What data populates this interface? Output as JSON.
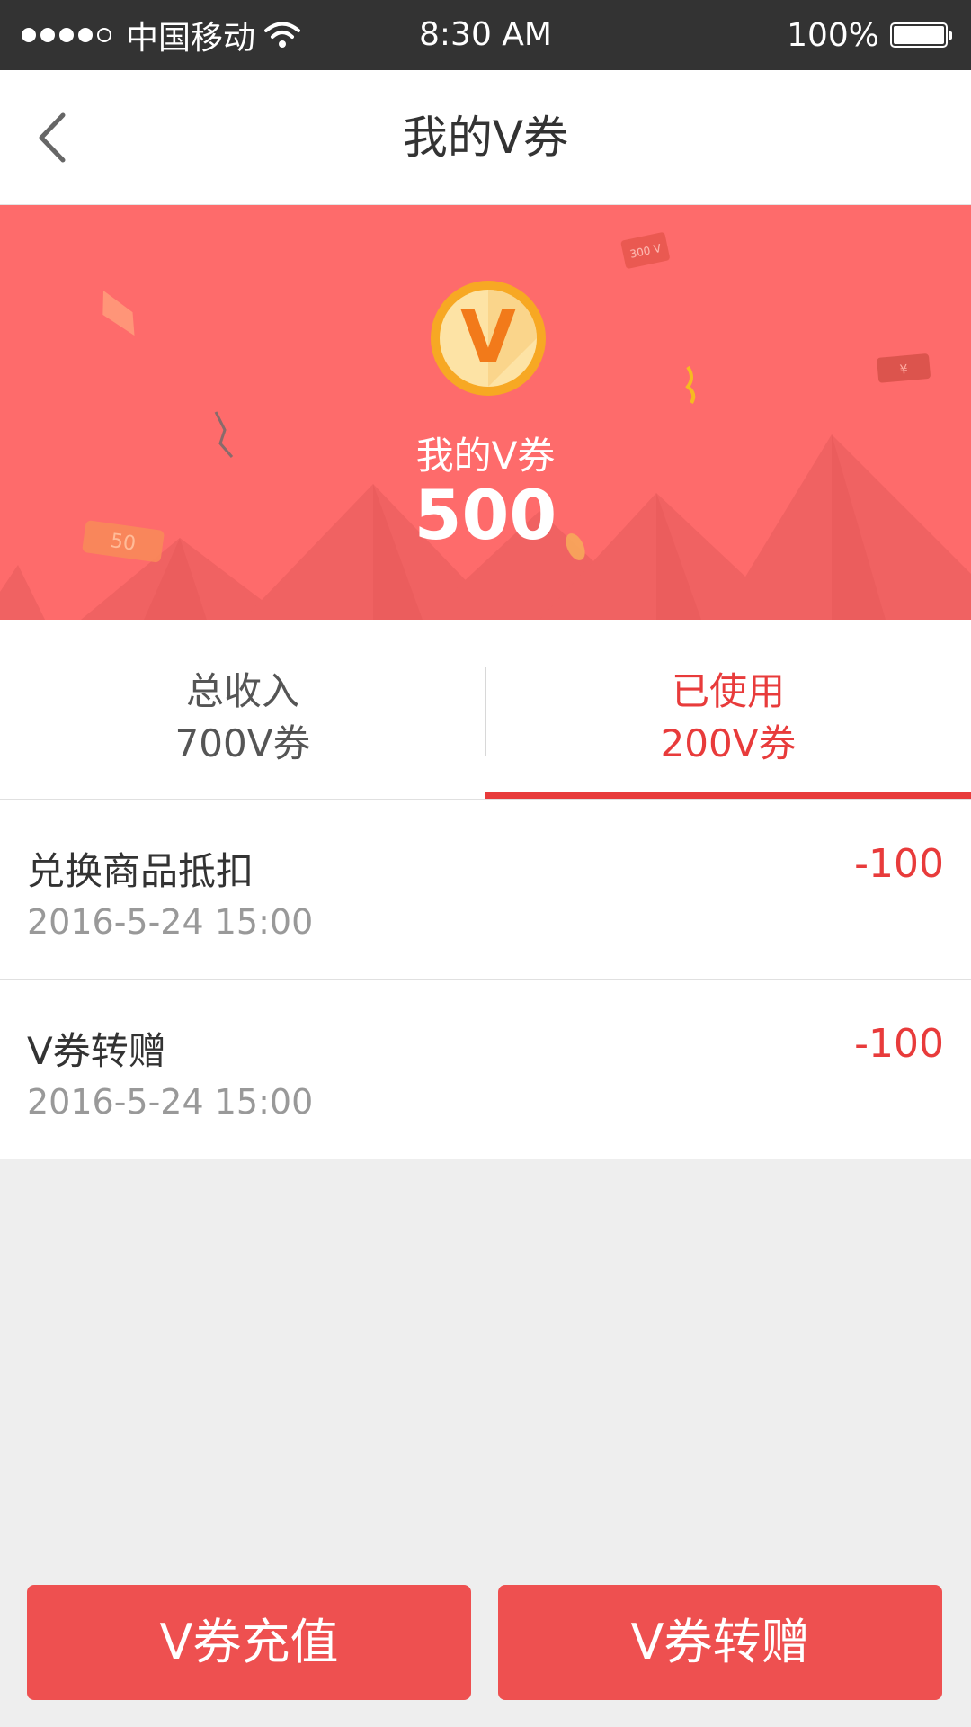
{
  "status_bar": {
    "carrier": "中国移动",
    "time": "8:30 AM",
    "battery_percent": "100%"
  },
  "nav": {
    "title": "我的V券"
  },
  "banner": {
    "coin_letter": "V",
    "label": "我的V券",
    "value": "500",
    "deco_300": "300 V",
    "deco_50": "50"
  },
  "tabs": [
    {
      "label": "总收入",
      "value": "700V券"
    },
    {
      "label": "已使用",
      "value": "200V券"
    }
  ],
  "records": [
    {
      "title": "兑换商品抵扣",
      "date": "2016-5-24 15:00",
      "amount": "-100"
    },
    {
      "title": "V券转赠",
      "date": "2016-5-24 15:00",
      "amount": "-100"
    }
  ],
  "buttons": {
    "recharge": "V券充值",
    "transfer": "V券转赠"
  },
  "colors": {
    "banner": "#fe6b6b",
    "accent": "#e83b3b",
    "button": "#ee5050",
    "coin": "#f5a623"
  }
}
